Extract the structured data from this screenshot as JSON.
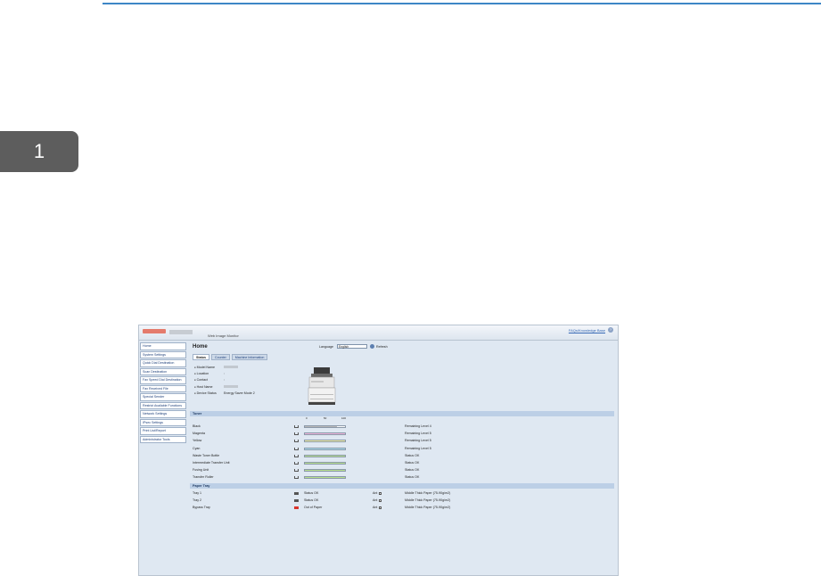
{
  "page": {
    "chapter_number": "1"
  },
  "app": {
    "header_title": "Web Image Monitor",
    "help_link": "FAQs/Knowledge Base",
    "help_icon_label": "?"
  },
  "sidebar": {
    "items": [
      "Home",
      "System Settings",
      "Quick Dial Destination",
      "Scan Destination",
      "Fax Speed Dial Destination",
      "Fax Received File",
      "Special Sender",
      "Restrict Available Functions",
      "Network Settings",
      "IPsec Settings",
      "Print List/Report",
      "Administrator Tools"
    ]
  },
  "main": {
    "title": "Home",
    "language_label": "Language",
    "language_value": "English",
    "refresh_label": "Refresh",
    "tabs": [
      "Status",
      "Counter",
      "Machine Information"
    ],
    "info": [
      {
        "label": "Model Name",
        "value": ""
      },
      {
        "label": "Location",
        "value": ":"
      },
      {
        "label": "Contact",
        "value": ":"
      },
      {
        "label": "Host Name",
        "value": ""
      },
      {
        "label": "Device Status",
        "value": "Energy Saver Mode 2"
      }
    ]
  },
  "toner": {
    "section_title": "Toner",
    "scale": [
      "0",
      "50",
      "100"
    ],
    "rows": [
      {
        "name": "Black",
        "status": "Remaining Level 4",
        "level": 0.8,
        "color": "#b8b8b8"
      },
      {
        "name": "Magenta",
        "status": "Remaining Level 5",
        "level": 1.0,
        "color": "#f0b4dc"
      },
      {
        "name": "Yellow",
        "status": "Remaining Level 5",
        "level": 1.0,
        "color": "#f6f1a0"
      },
      {
        "name": "Cyan",
        "status": "Remaining Level 5",
        "level": 1.0,
        "color": "#a9dced"
      },
      {
        "name": "Waste Toner Bottle",
        "status": "Status OK",
        "level": 1.0,
        "color": "#b7e08e"
      },
      {
        "name": "Intermediate Transfer Unit",
        "status": "Status OK",
        "level": 1.0,
        "color": "#b7e08e"
      },
      {
        "name": "Fusing Unit",
        "status": "Status OK",
        "level": 1.0,
        "color": "#b7e08e"
      },
      {
        "name": "Transfer Roller",
        "status": "Status OK",
        "level": 1.0,
        "color": "#b7e08e"
      }
    ]
  },
  "paper_tray": {
    "section_title": "Paper Tray",
    "rows": [
      {
        "name": "Tray 1",
        "status": "Status OK",
        "auto": "Ant",
        "paper": "Middle Thick Paper (75-90g/m2)",
        "icon_color": "#555555"
      },
      {
        "name": "Tray 2",
        "status": "Status OK",
        "auto": "Ant",
        "paper": "Middle Thick Paper (75-90g/m2)",
        "icon_color": "#555555"
      },
      {
        "name": "Bypass Tray",
        "status": "Out of Paper",
        "auto": "Ant",
        "paper": "Middle Thick Paper (75-90g/m2)",
        "icon_color": "#d9342b"
      }
    ]
  }
}
